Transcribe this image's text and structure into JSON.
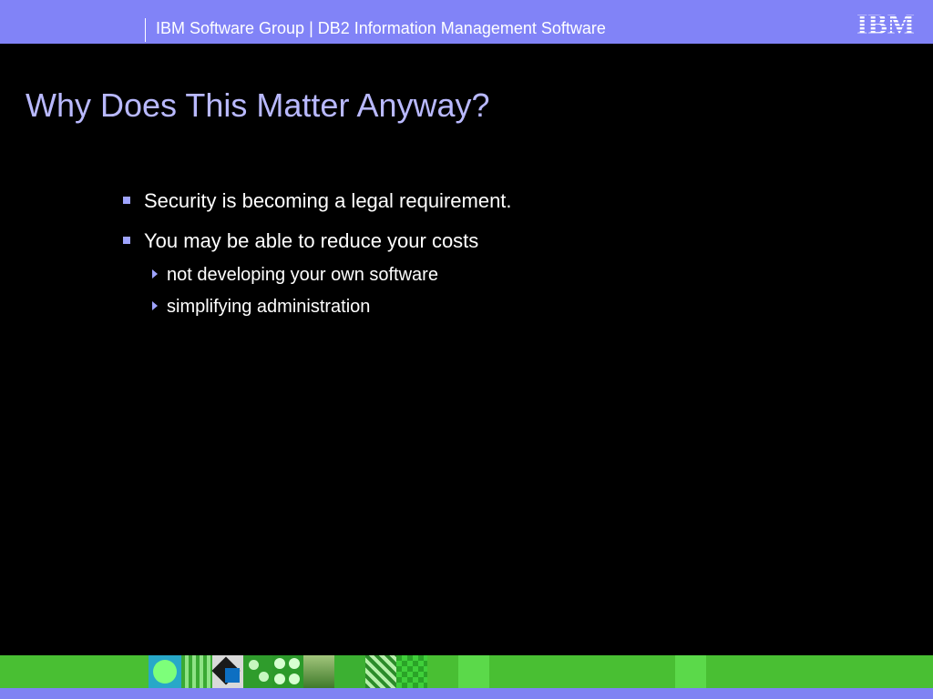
{
  "header": {
    "text": "IBM Software Group | DB2 Information Management Software",
    "logo_text": "IBM"
  },
  "slide": {
    "title": "Why Does This Matter Anyway?",
    "bullets": [
      {
        "text": "Security is becoming a legal requirement.",
        "sub": []
      },
      {
        "text": "You may be able to reduce your costs",
        "sub": [
          "not developing your own software",
          "simplifying administration"
        ]
      }
    ]
  },
  "colors": {
    "header_bg": "#8183f7",
    "title": "#b9b9ff",
    "bullet_marker": "#9fa4ff",
    "footer_green": "#49bf33"
  },
  "icons": {
    "bullet_level_1": "square-bullet-icon",
    "bullet_level_2": "triangle-right-icon"
  }
}
